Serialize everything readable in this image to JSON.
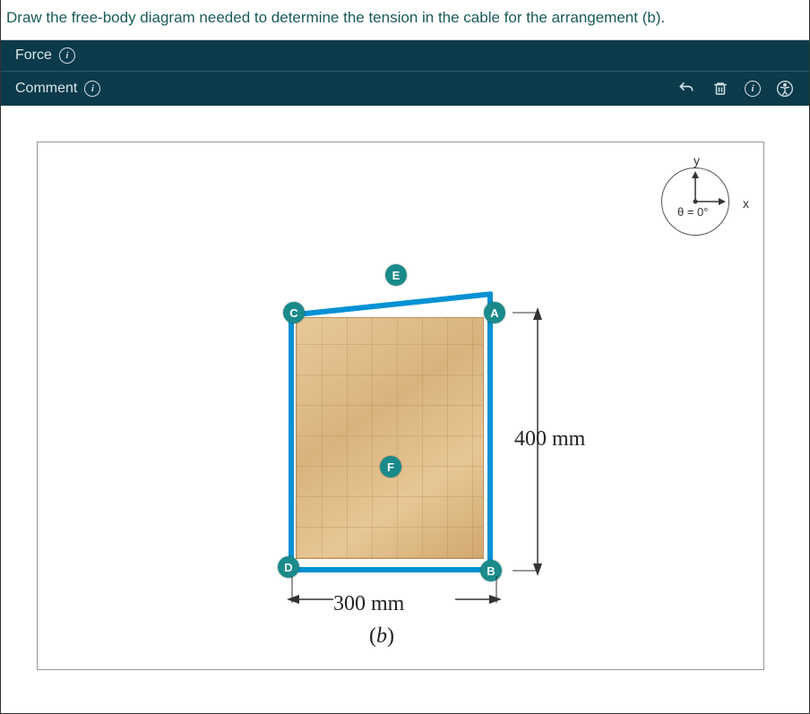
{
  "instruction": "Draw the free-body diagram needed to determine the tension in the cable for the arrangement (b).",
  "tabs": {
    "force_label": "Force",
    "comment_label": "Comment"
  },
  "compass": {
    "y": "y",
    "x": "x",
    "theta": "θ = 0°"
  },
  "diagram": {
    "nodes": {
      "A": "A",
      "B": "B",
      "C": "C",
      "D": "D",
      "E": "E",
      "F": "F"
    },
    "dim_v": "400 mm",
    "dim_h": "300 mm",
    "fig": "b"
  },
  "colors": {
    "panel_bg": "#0b3a4a",
    "accent": "#1a8a8a",
    "frame": "#0091d4"
  }
}
